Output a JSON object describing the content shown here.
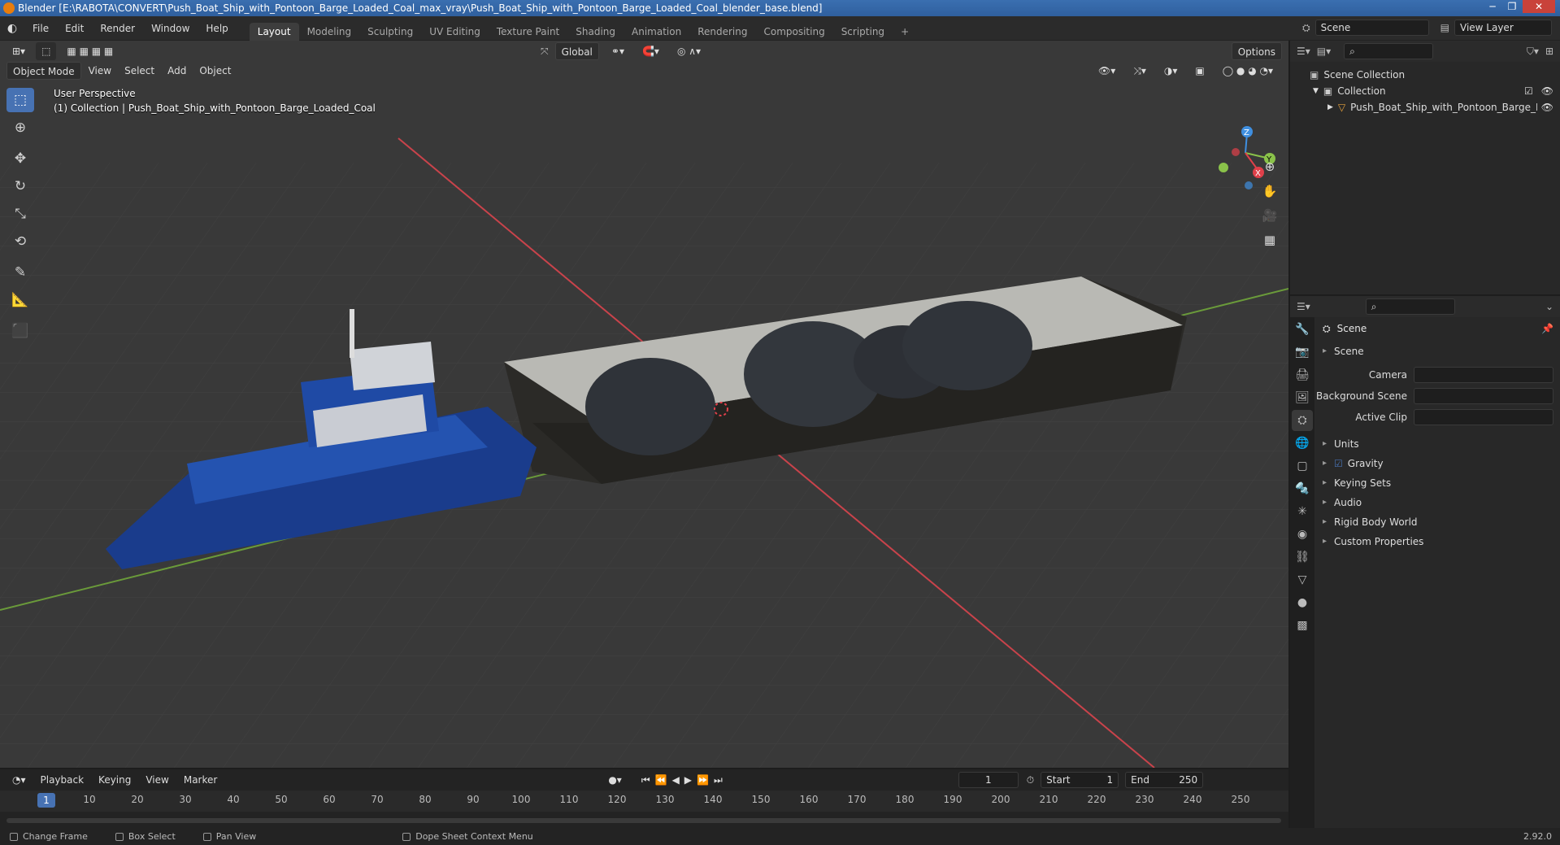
{
  "window": {
    "title": "Blender [E:\\RABOTA\\CONVERT\\Push_Boat_Ship_with_Pontoon_Barge_Loaded_Coal_max_vray\\Push_Boat_Ship_with_Pontoon_Barge_Loaded_Coal_blender_base.blend]"
  },
  "menubar": {
    "menus": [
      "File",
      "Edit",
      "Render",
      "Window",
      "Help"
    ],
    "workspaces": [
      "Layout",
      "Modeling",
      "Sculpting",
      "UV Editing",
      "Texture Paint",
      "Shading",
      "Animation",
      "Rendering",
      "Compositing",
      "Scripting"
    ],
    "add_tab": "+",
    "scene_label": "Scene",
    "view_layer_label": "View Layer"
  },
  "viewport": {
    "mode": "Object Mode",
    "header_menus": [
      "View",
      "Select",
      "Add",
      "Object"
    ],
    "transform_orientation": "Global",
    "options_label": "Options",
    "perspective_label": "User Perspective",
    "collection_label": "(1) Collection | Push_Boat_Ship_with_Pontoon_Barge_Loaded_Coal",
    "gizmo_axes": {
      "x": "X",
      "y": "Y",
      "z": "Z"
    }
  },
  "outliner": {
    "rows": [
      {
        "label": "Scene Collection"
      },
      {
        "label": "Collection"
      },
      {
        "label": "Push_Boat_Ship_with_Pontoon_Barge_Lc"
      }
    ]
  },
  "properties": {
    "title": "Scene",
    "section_title": "Scene",
    "fields": [
      {
        "label": "Camera"
      },
      {
        "label": "Background Scene"
      },
      {
        "label": "Active Clip"
      }
    ],
    "sections": [
      "Units",
      "Gravity",
      "Keying Sets",
      "Audio",
      "Rigid Body World",
      "Custom Properties"
    ],
    "gravity_checked": true
  },
  "timeline": {
    "menus": [
      "Playback",
      "Keying",
      "View",
      "Marker"
    ],
    "current_frame": "1",
    "start_label": "Start",
    "start_value": "1",
    "end_label": "End",
    "end_value": "250",
    "ticks": [
      "10",
      "20",
      "30",
      "40",
      "50",
      "60",
      "70",
      "80",
      "90",
      "100",
      "110",
      "120",
      "130",
      "140",
      "150",
      "160",
      "170",
      "180",
      "190",
      "200",
      "210",
      "220",
      "230",
      "240",
      "250"
    ],
    "cursor_label": "1"
  },
  "statusbar": {
    "items": [
      "Change Frame",
      "Box Select",
      "Pan View",
      "Dope Sheet Context Menu"
    ],
    "version": "2.92.0"
  },
  "colors": {
    "accent": "#4772b3",
    "x_axis": "#e0404a",
    "y_axis": "#8ac24a",
    "z_axis": "#3f8fe0"
  }
}
